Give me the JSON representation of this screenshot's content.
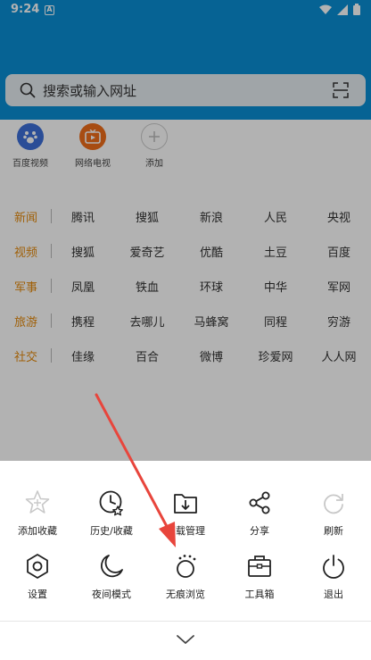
{
  "status_bar": {
    "time": "9:24",
    "notification_badge": "A",
    "icons": [
      "wifi-icon",
      "signal-icon",
      "battery-icon"
    ]
  },
  "search": {
    "placeholder": "搜索或输入网址",
    "left_icon": "search-icon",
    "right_icon": "scan-icon"
  },
  "shortcuts": [
    {
      "label": "百度视频",
      "icon": "baidu-paw-icon",
      "color": "#3d6fd8"
    },
    {
      "label": "网络电视",
      "icon": "tv-icon",
      "color": "#ef6d1b"
    },
    {
      "label": "添加",
      "icon": "add-icon",
      "color": "#cccccc"
    }
  ],
  "nav": [
    {
      "category": "新闻",
      "sites": [
        "腾讯",
        "搜狐",
        "新浪",
        "人民",
        "央视"
      ]
    },
    {
      "category": "视频",
      "sites": [
        "搜狐",
        "爱奇艺",
        "优酷",
        "土豆",
        "百度"
      ]
    },
    {
      "category": "军事",
      "sites": [
        "凤凰",
        "铁血",
        "环球",
        "中华",
        "军网"
      ]
    },
    {
      "category": "旅游",
      "sites": [
        "携程",
        "去哪儿",
        "马蜂窝",
        "同程",
        "穷游"
      ]
    },
    {
      "category": "社交",
      "sites": [
        "佳缘",
        "百合",
        "微博",
        "珍爱网",
        "人人网"
      ]
    }
  ],
  "menu": {
    "row1": [
      {
        "label": "添加收藏",
        "icon": "star-plus-icon",
        "enabled": false
      },
      {
        "label": "历史/收藏",
        "icon": "history-icon",
        "enabled": true
      },
      {
        "label": "下载管理",
        "icon": "download-icon",
        "enabled": true
      },
      {
        "label": "分享",
        "icon": "share-icon",
        "enabled": true
      },
      {
        "label": "刷新",
        "icon": "refresh-icon",
        "enabled": false
      }
    ],
    "row2": [
      {
        "label": "设置",
        "icon": "gear-icon",
        "enabled": true
      },
      {
        "label": "夜间模式",
        "icon": "moon-icon",
        "enabled": true
      },
      {
        "label": "无痕浏览",
        "icon": "incognito-icon",
        "enabled": true
      },
      {
        "label": "工具箱",
        "icon": "toolbox-icon",
        "enabled": true
      },
      {
        "label": "退出",
        "icon": "power-icon",
        "enabled": true
      }
    ],
    "collapse_icon": "chevron-down-icon"
  },
  "colors": {
    "brand_blue": "#0a8fd4",
    "category_orange": "#e58a0c",
    "annotation_red": "#e8453c",
    "dim_overlay": "rgba(0,0,0,0.3)"
  }
}
